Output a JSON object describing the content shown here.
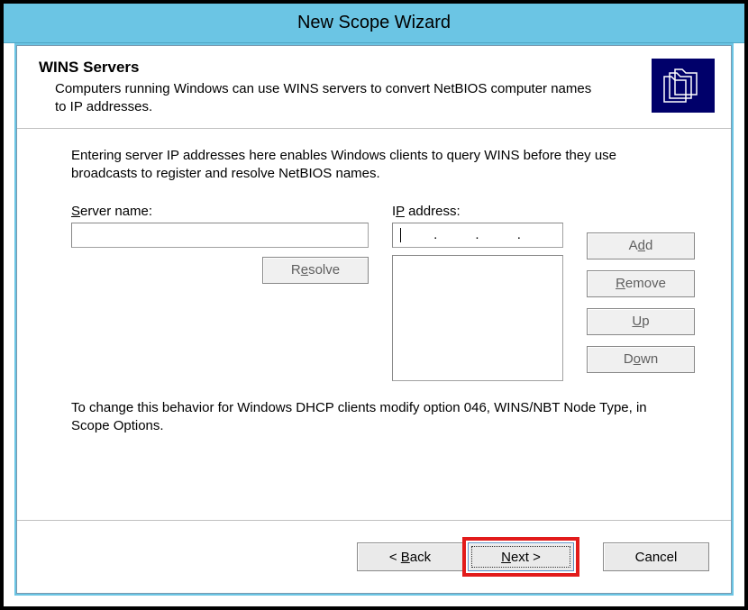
{
  "window": {
    "title": "New Scope Wizard"
  },
  "header": {
    "title": "WINS Servers",
    "subtitle": "Computers running Windows can use WINS servers to convert NetBIOS computer names to IP addresses."
  },
  "content": {
    "instruction": "Entering server IP addresses here enables Windows clients to query WINS before they use broadcasts to register and resolve NetBIOS names.",
    "server_name_label": "Server name:",
    "server_name_value": "",
    "ip_label": "IP address:",
    "ip_value": "",
    "resolve_label": "Resolve",
    "add_label": "Add",
    "remove_label": "Remove",
    "up_label": "Up",
    "down_label": "Down",
    "note": "To change this behavior for Windows DHCP clients modify option 046, WINS/NBT Node Type, in Scope Options."
  },
  "footer": {
    "back_label": "< Back",
    "next_label": "Next >",
    "cancel_label": "Cancel"
  }
}
